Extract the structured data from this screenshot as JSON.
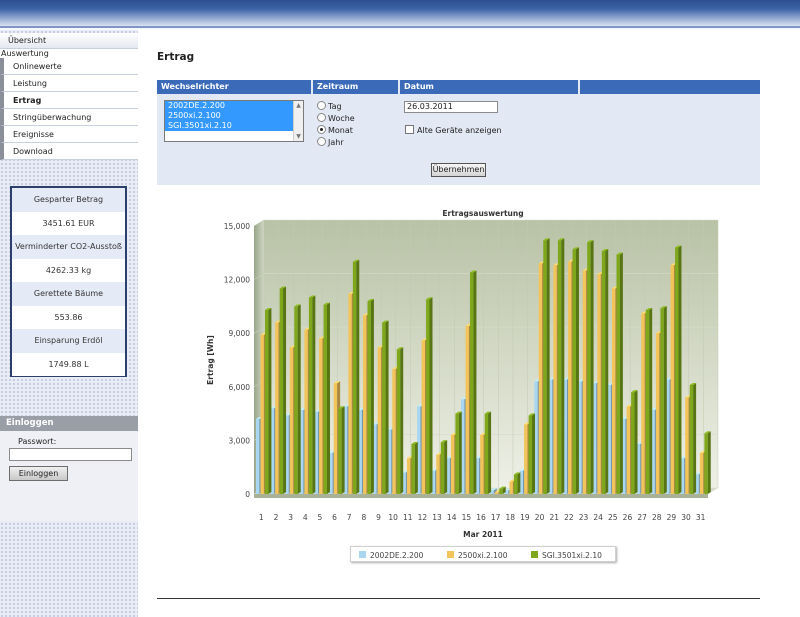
{
  "sidebar": {
    "nav_top": "Übersicht",
    "group_label": "Auswertung",
    "items": [
      {
        "label": "Onlinewerte",
        "active": false
      },
      {
        "label": "Leistung",
        "active": false
      },
      {
        "label": "Ertrag",
        "active": true
      },
      {
        "label": "Stringüberwachung",
        "active": false
      },
      {
        "label": "Ereignisse",
        "active": false
      },
      {
        "label": "Download",
        "active": false
      }
    ],
    "stats": [
      {
        "label": "Gesparter Betrag",
        "value": "3451.61 EUR"
      },
      {
        "label": "Verminderter CO2-Ausstoß",
        "value": "4262.33 kg"
      },
      {
        "label": "Gerettete Bäume",
        "value": "553.86"
      },
      {
        "label": "Einsparung Erdöl",
        "value": "1749.88 L"
      }
    ],
    "login": {
      "title": "Einloggen",
      "password_label": "Passwort:",
      "password_value": "",
      "button": "Einloggen"
    }
  },
  "main": {
    "title": "Ertrag",
    "filter": {
      "headers": [
        "Wechselrichter",
        "Zeitraum",
        "Datum"
      ],
      "inverters": [
        "2002DE.2.200",
        "2500xi.2.100",
        "SGI.3501xi.2.10"
      ],
      "periods": [
        {
          "label": "Tag",
          "selected": false
        },
        {
          "label": "Woche",
          "selected": false
        },
        {
          "label": "Monat",
          "selected": true
        },
        {
          "label": "Jahr",
          "selected": false
        }
      ],
      "date": "26.03.2011",
      "checkbox_label": "Alte Geräte anzeigen",
      "checkbox_checked": false,
      "apply_button": "Übernehmen"
    }
  },
  "chart_data": {
    "type": "bar",
    "title": "Ertragsauswertung",
    "xlabel": "Mar 2011",
    "ylabel": "Ertrag [Wh]",
    "ylim": [
      0,
      15000
    ],
    "yticks": [
      0,
      3000,
      6000,
      9000,
      12000,
      15000
    ],
    "ytick_labels": [
      "0",
      "3,000",
      "6,000",
      "9,000",
      "12,000",
      "15,000"
    ],
    "categories": [
      "1",
      "2",
      "3",
      "4",
      "5",
      "6",
      "7",
      "8",
      "9",
      "10",
      "11",
      "12",
      "13",
      "14",
      "15",
      "16",
      "17",
      "18",
      "19",
      "20",
      "21",
      "22",
      "23",
      "24",
      "25",
      "26",
      "27",
      "28",
      "29",
      "30",
      "31"
    ],
    "series": [
      {
        "name": "2002DE.2.200",
        "color": "#a9d6f0",
        "values": [
          4200,
          4800,
          4400,
          4700,
          4600,
          2300,
          4900,
          4700,
          3900,
          3600,
          1200,
          4900,
          1300,
          2000,
          5300,
          2000,
          200,
          200,
          1300,
          6300,
          6400,
          6400,
          6300,
          6200,
          6100,
          4200,
          2800,
          4700,
          6400,
          2000,
          1100
        ]
      },
      {
        "name": "2500xi.2.100",
        "color": "#f2c45a",
        "values": [
          8900,
          9600,
          8200,
          9200,
          8700,
          6200,
          11200,
          10000,
          8200,
          7000,
          2000,
          8600,
          2200,
          3300,
          9400,
          3300,
          100,
          700,
          3900,
          12900,
          12800,
          13000,
          12500,
          12300,
          11500,
          4900,
          10100,
          9000,
          12800,
          5400,
          2300
        ]
      },
      {
        "name": "SGI.3501xi.2.10",
        "color": "#7ea71c",
        "values": [
          10300,
          11500,
          10500,
          11000,
          10600,
          4800,
          13000,
          10800,
          9600,
          8100,
          2800,
          10900,
          2900,
          4500,
          12400,
          4500,
          300,
          1100,
          4400,
          14200,
          14200,
          13700,
          14100,
          13600,
          13400,
          5700,
          10300,
          10400,
          13800,
          6100,
          3400
        ]
      }
    ],
    "legend_position": "bottom",
    "grid": true
  }
}
